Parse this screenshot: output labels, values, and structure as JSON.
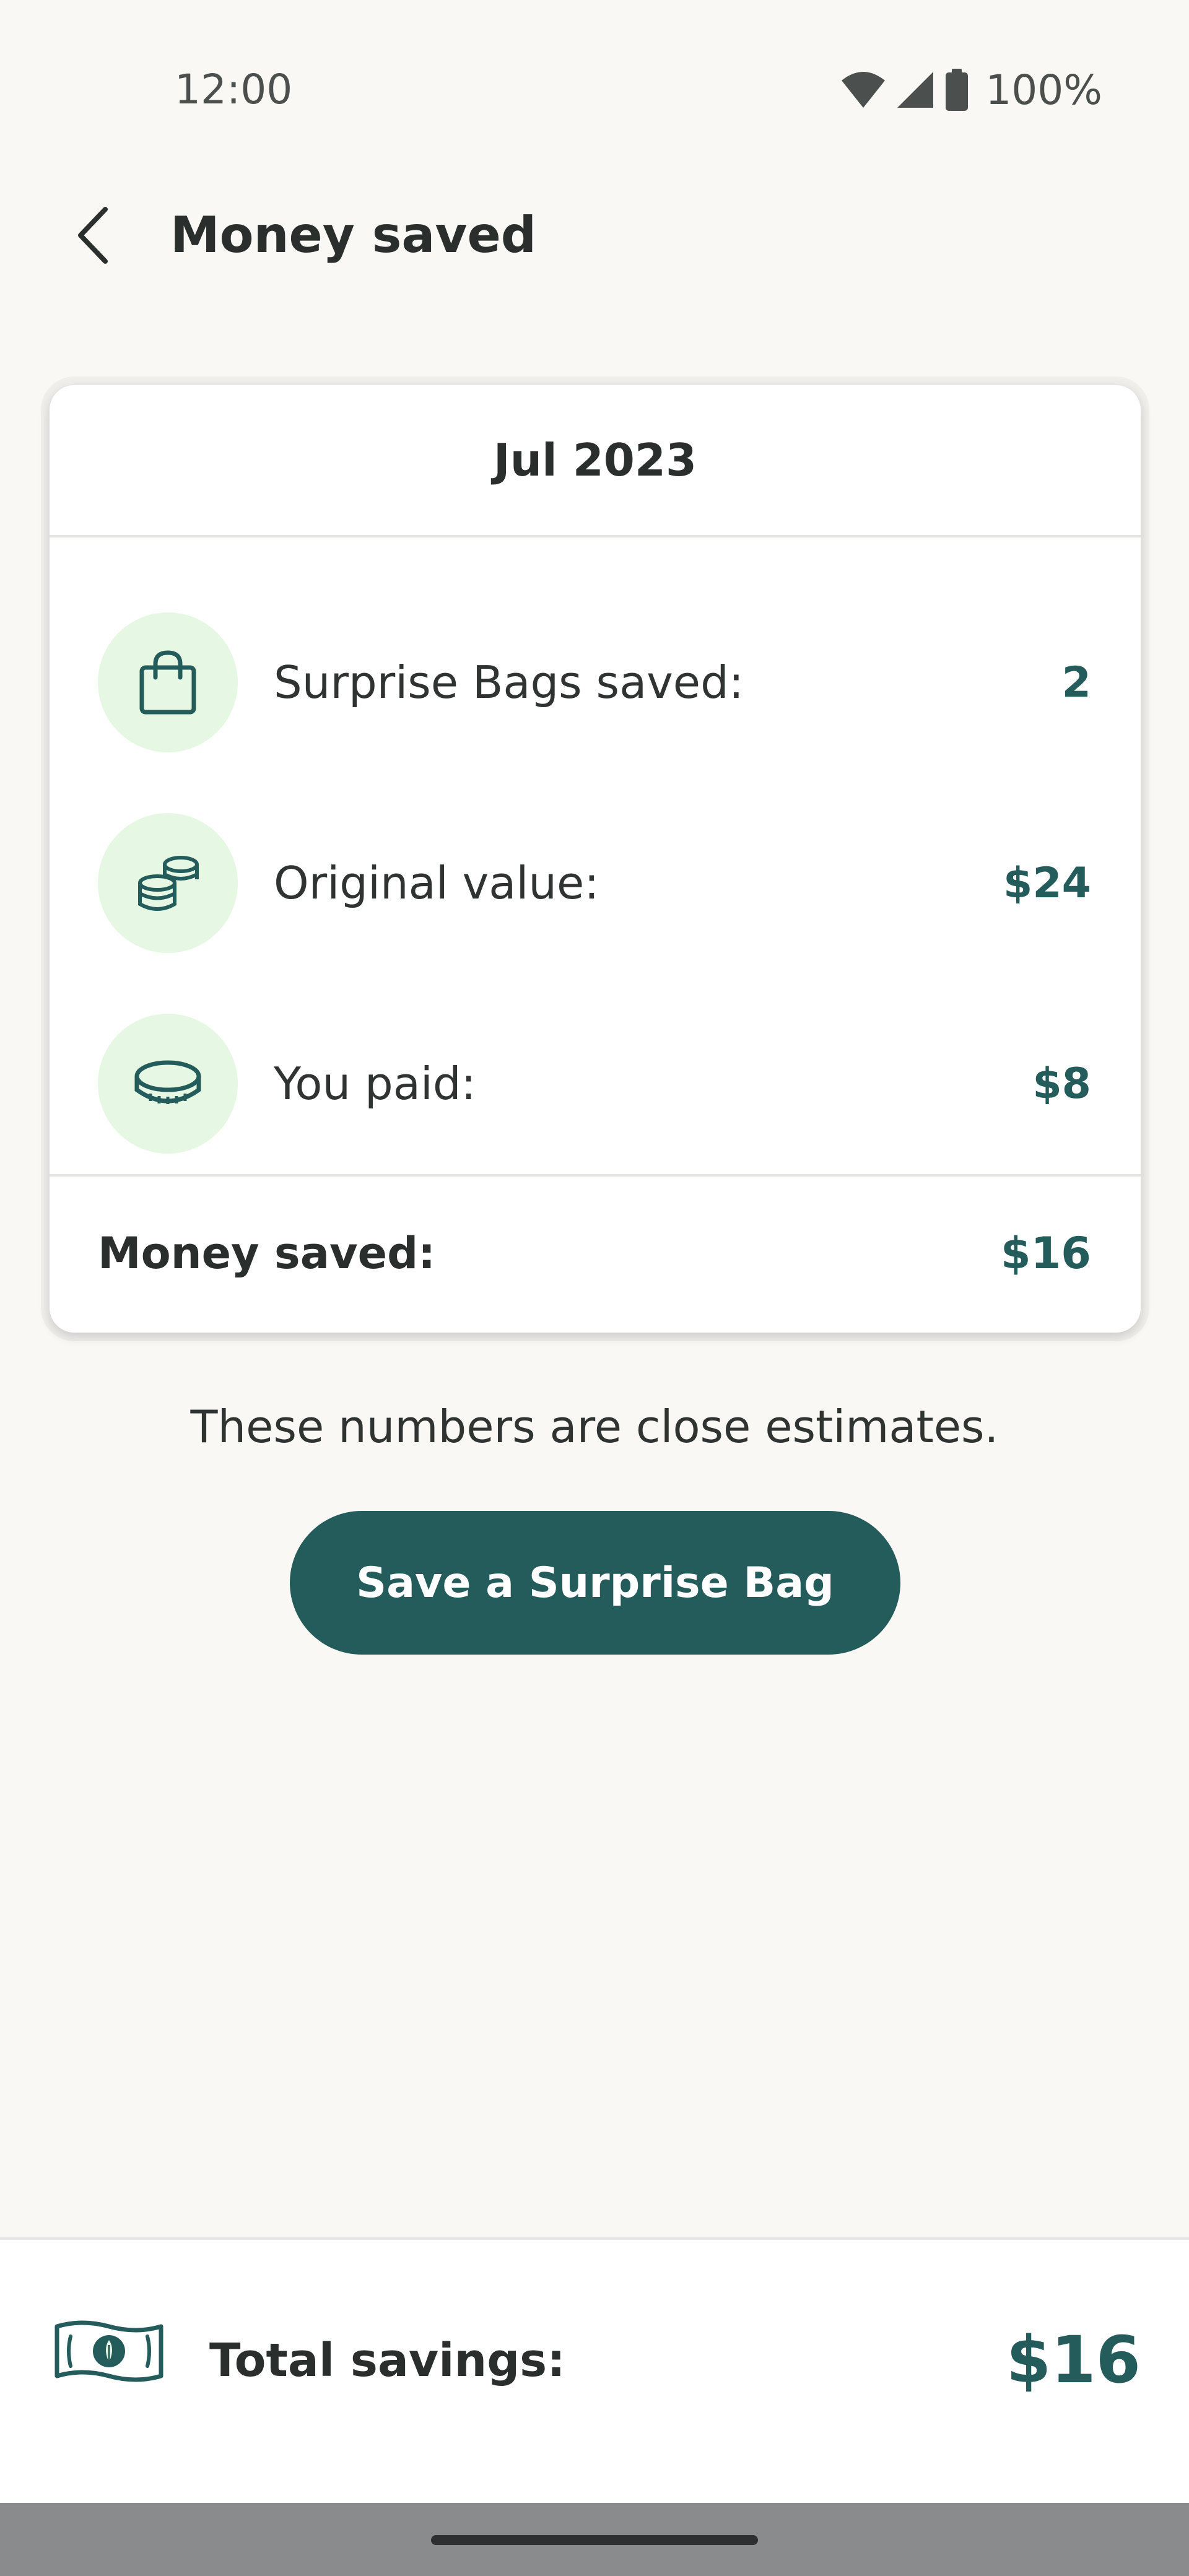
{
  "status_bar": {
    "time": "12:00",
    "battery": "100%",
    "icons": [
      "wifi-icon",
      "signal-icon",
      "battery-icon"
    ]
  },
  "app_bar": {
    "title": "Money saved",
    "back_icon": "chevron-left-icon"
  },
  "card": {
    "month": "Jul 2023",
    "rows": [
      {
        "icon": "shopping-bag-icon",
        "label": "Surprise Bags saved:",
        "value": "2"
      },
      {
        "icon": "coins-stack-icon",
        "label": "Original value:",
        "value": "$24"
      },
      {
        "icon": "coin-icon",
        "label": "You paid:",
        "value": "$8"
      }
    ],
    "footer": {
      "label": "Money saved:",
      "value": "$16"
    }
  },
  "disclaimer": "These numbers are close estimates.",
  "cta": {
    "label": "Save a Surprise Bag"
  },
  "summary": {
    "icon": "banknote-icon",
    "label": "Total savings:",
    "value": "$16"
  },
  "colors": {
    "background": "#f9f8f5",
    "accent": "#235c5a",
    "icon_circle": "#e6f8e3",
    "card": "#ffffff"
  }
}
